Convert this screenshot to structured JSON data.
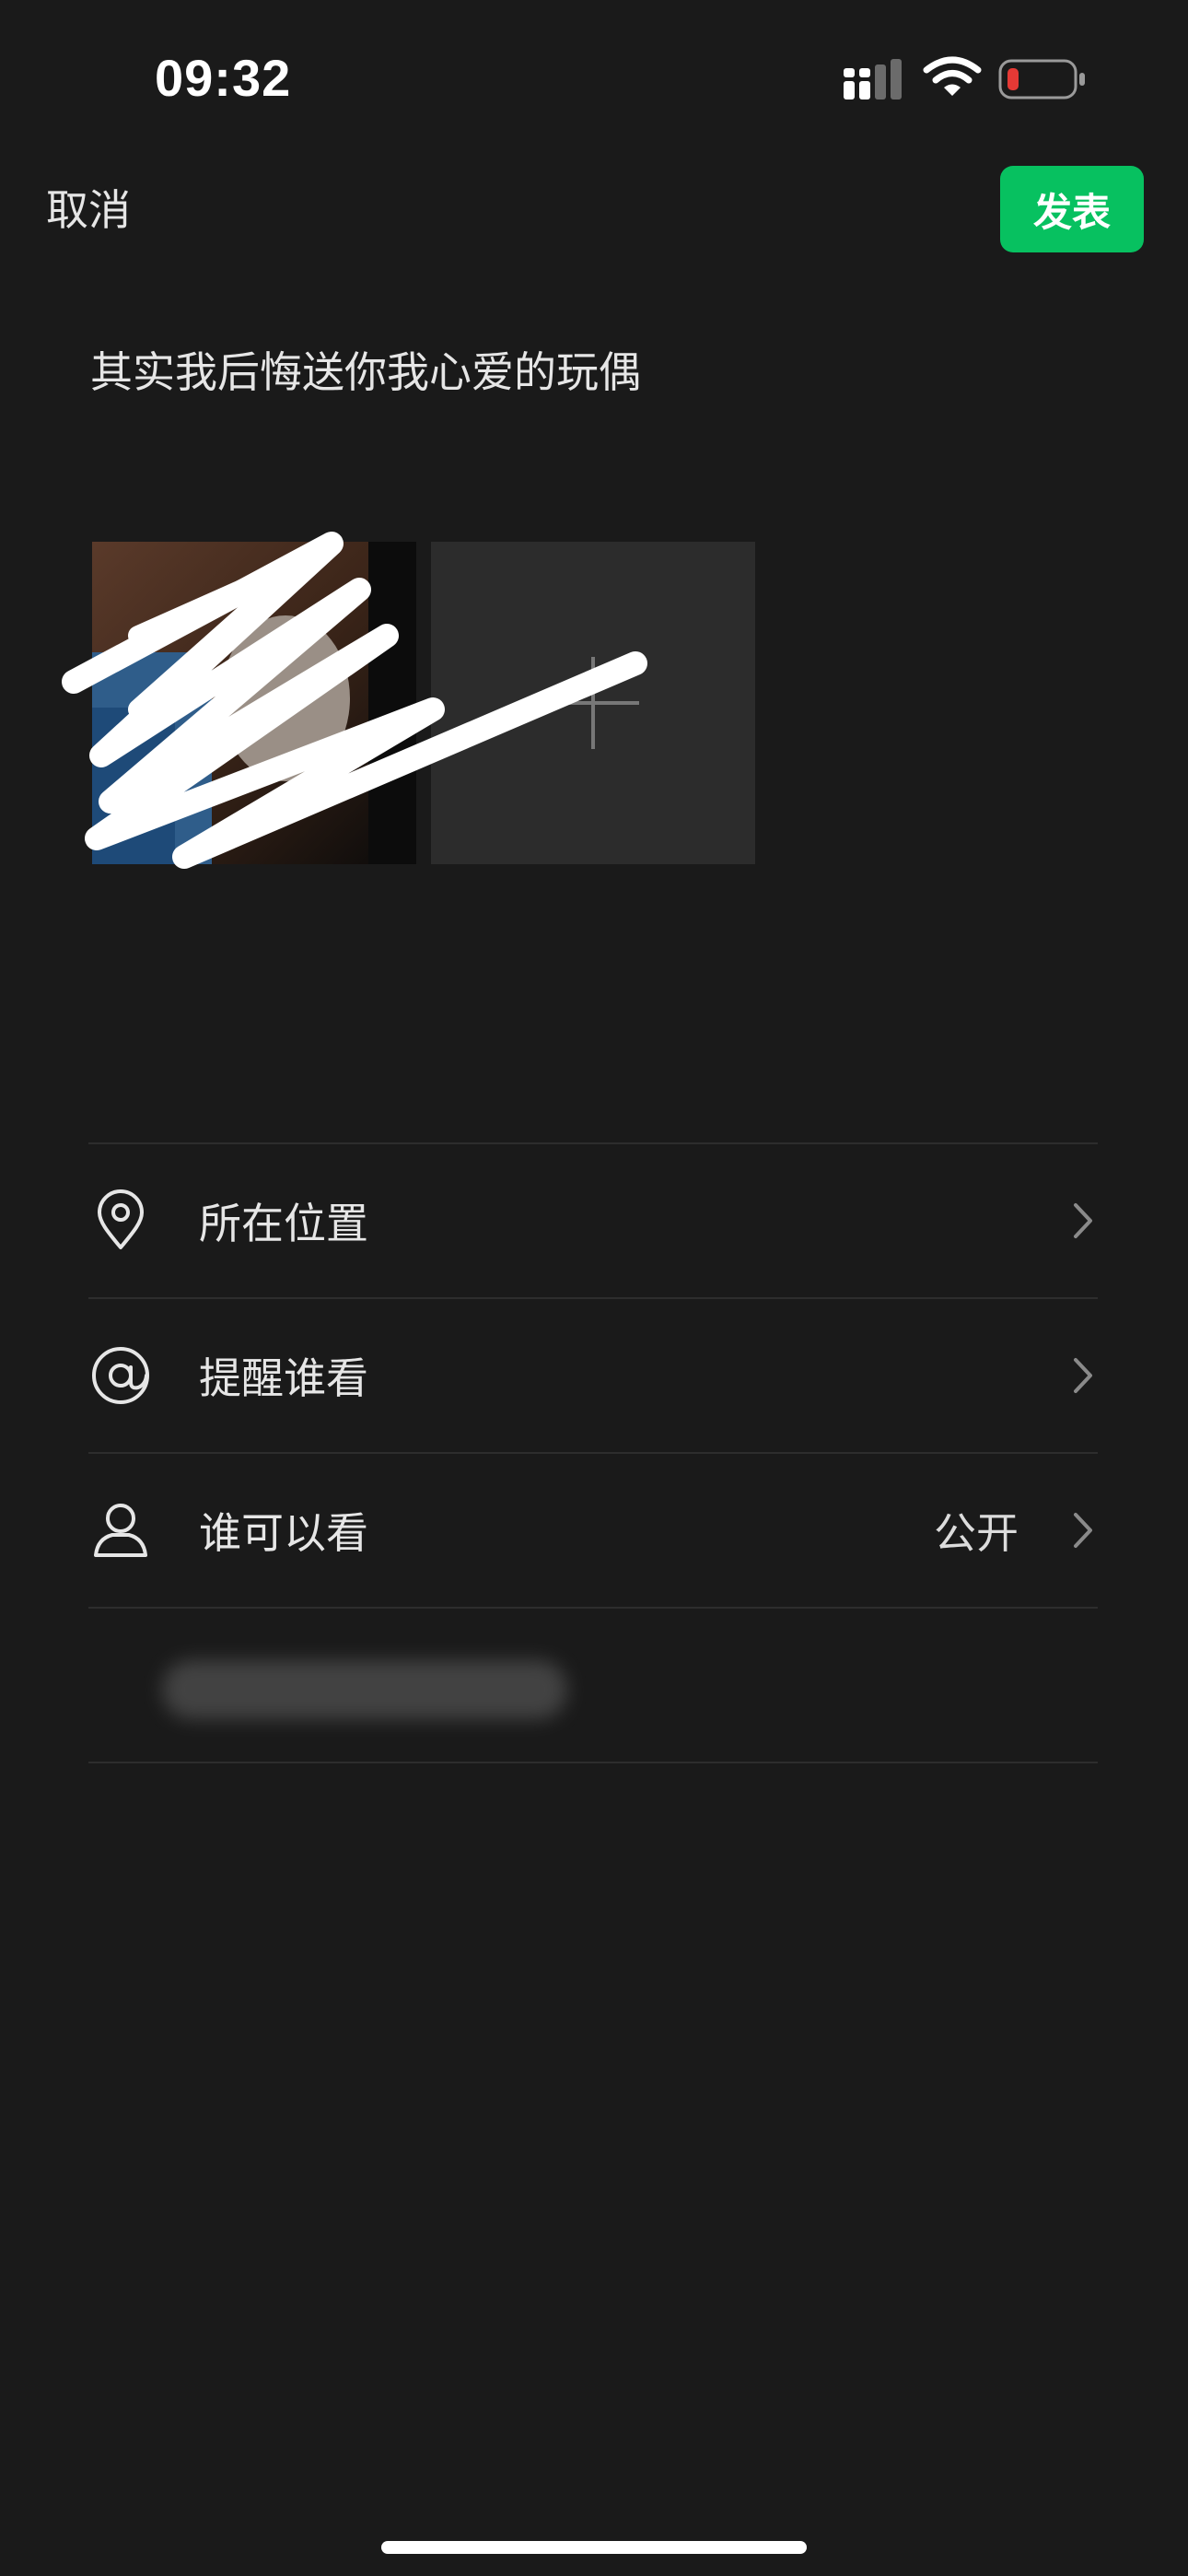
{
  "status_bar": {
    "time": "09:32",
    "icons": [
      "cellular-signal-icon",
      "wifi-icon",
      "battery-low-icon"
    ],
    "battery_color": "#e53935"
  },
  "nav": {
    "cancel_label": "取消",
    "publish_label": "发表",
    "publish_color": "#07c160"
  },
  "post": {
    "text": "其实我后悔送你我心爱的玩偶"
  },
  "photos": {
    "count": 1,
    "add_icon": "plus-icon"
  },
  "options": [
    {
      "icon": "location-pin-icon",
      "label": "所在位置",
      "value": ""
    },
    {
      "icon": "at-sign-icon",
      "label": "提醒谁看",
      "value": ""
    },
    {
      "icon": "person-icon",
      "label": "谁可以看",
      "value": "公开"
    }
  ]
}
